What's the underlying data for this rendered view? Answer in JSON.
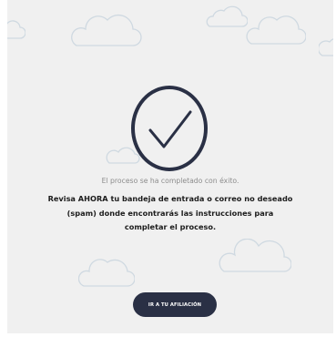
{
  "status_text": "El proceso se ha completado con éxito.",
  "instructions": [
    "Revisa AHORA tu bandeja de entrada o correo no deseado",
    "(spam) donde encontrarás las instrucciones para",
    "completar el proceso."
  ],
  "cta_label": "IR A TU AFILIACIÓN",
  "icons": {
    "success": "check-circle-icon",
    "background": "cloud-icon"
  },
  "colors": {
    "panel_background": "#f0f0f0",
    "check_stroke": "#2a3045",
    "button_background": "#2a3045",
    "button_text": "#ffffff",
    "status_text": "#8d8d8d",
    "instructions_text": "#1c1c1c",
    "cloud_outline": "#cfd9e1"
  }
}
